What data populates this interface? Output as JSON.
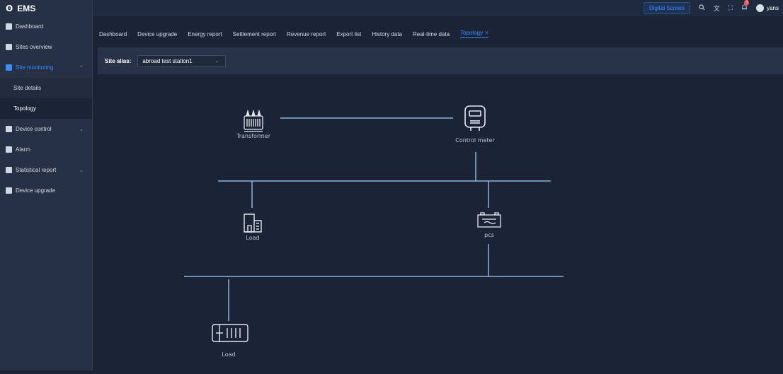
{
  "app": {
    "title": "EMS"
  },
  "sidebar": {
    "items": [
      {
        "label": "Dashboard"
      },
      {
        "label": "Sites overview"
      },
      {
        "label": "Site monitoring"
      },
      {
        "label": "Device control"
      },
      {
        "label": "Alarm"
      },
      {
        "label": "Statistical report"
      },
      {
        "label": "Device upgrade"
      }
    ],
    "sub_items": [
      {
        "label": "Site details"
      },
      {
        "label": "Topology"
      }
    ]
  },
  "header": {
    "digital_screen": "Digital Screen",
    "notification_count": "3",
    "username": "yans"
  },
  "tabs": [
    {
      "label": "Dashboard"
    },
    {
      "label": "Device upgrade"
    },
    {
      "label": "Energy report"
    },
    {
      "label": "Settlement report"
    },
    {
      "label": "Revenue report"
    },
    {
      "label": "Export list"
    },
    {
      "label": "History data"
    },
    {
      "label": "Real-time data"
    },
    {
      "label": "Topology"
    }
  ],
  "filter": {
    "label": "Site alias:",
    "value": "abroad test station1"
  },
  "topology": {
    "nodes": {
      "transformer": "Transformer",
      "control_meter": "Control meter",
      "load_1": "Load",
      "pcs": "pcs",
      "load_2": "Load"
    }
  },
  "colors": {
    "accent": "#3b8cff",
    "line": "#8fb3d9",
    "background": "#1a2436",
    "sidebar": "#263145"
  }
}
